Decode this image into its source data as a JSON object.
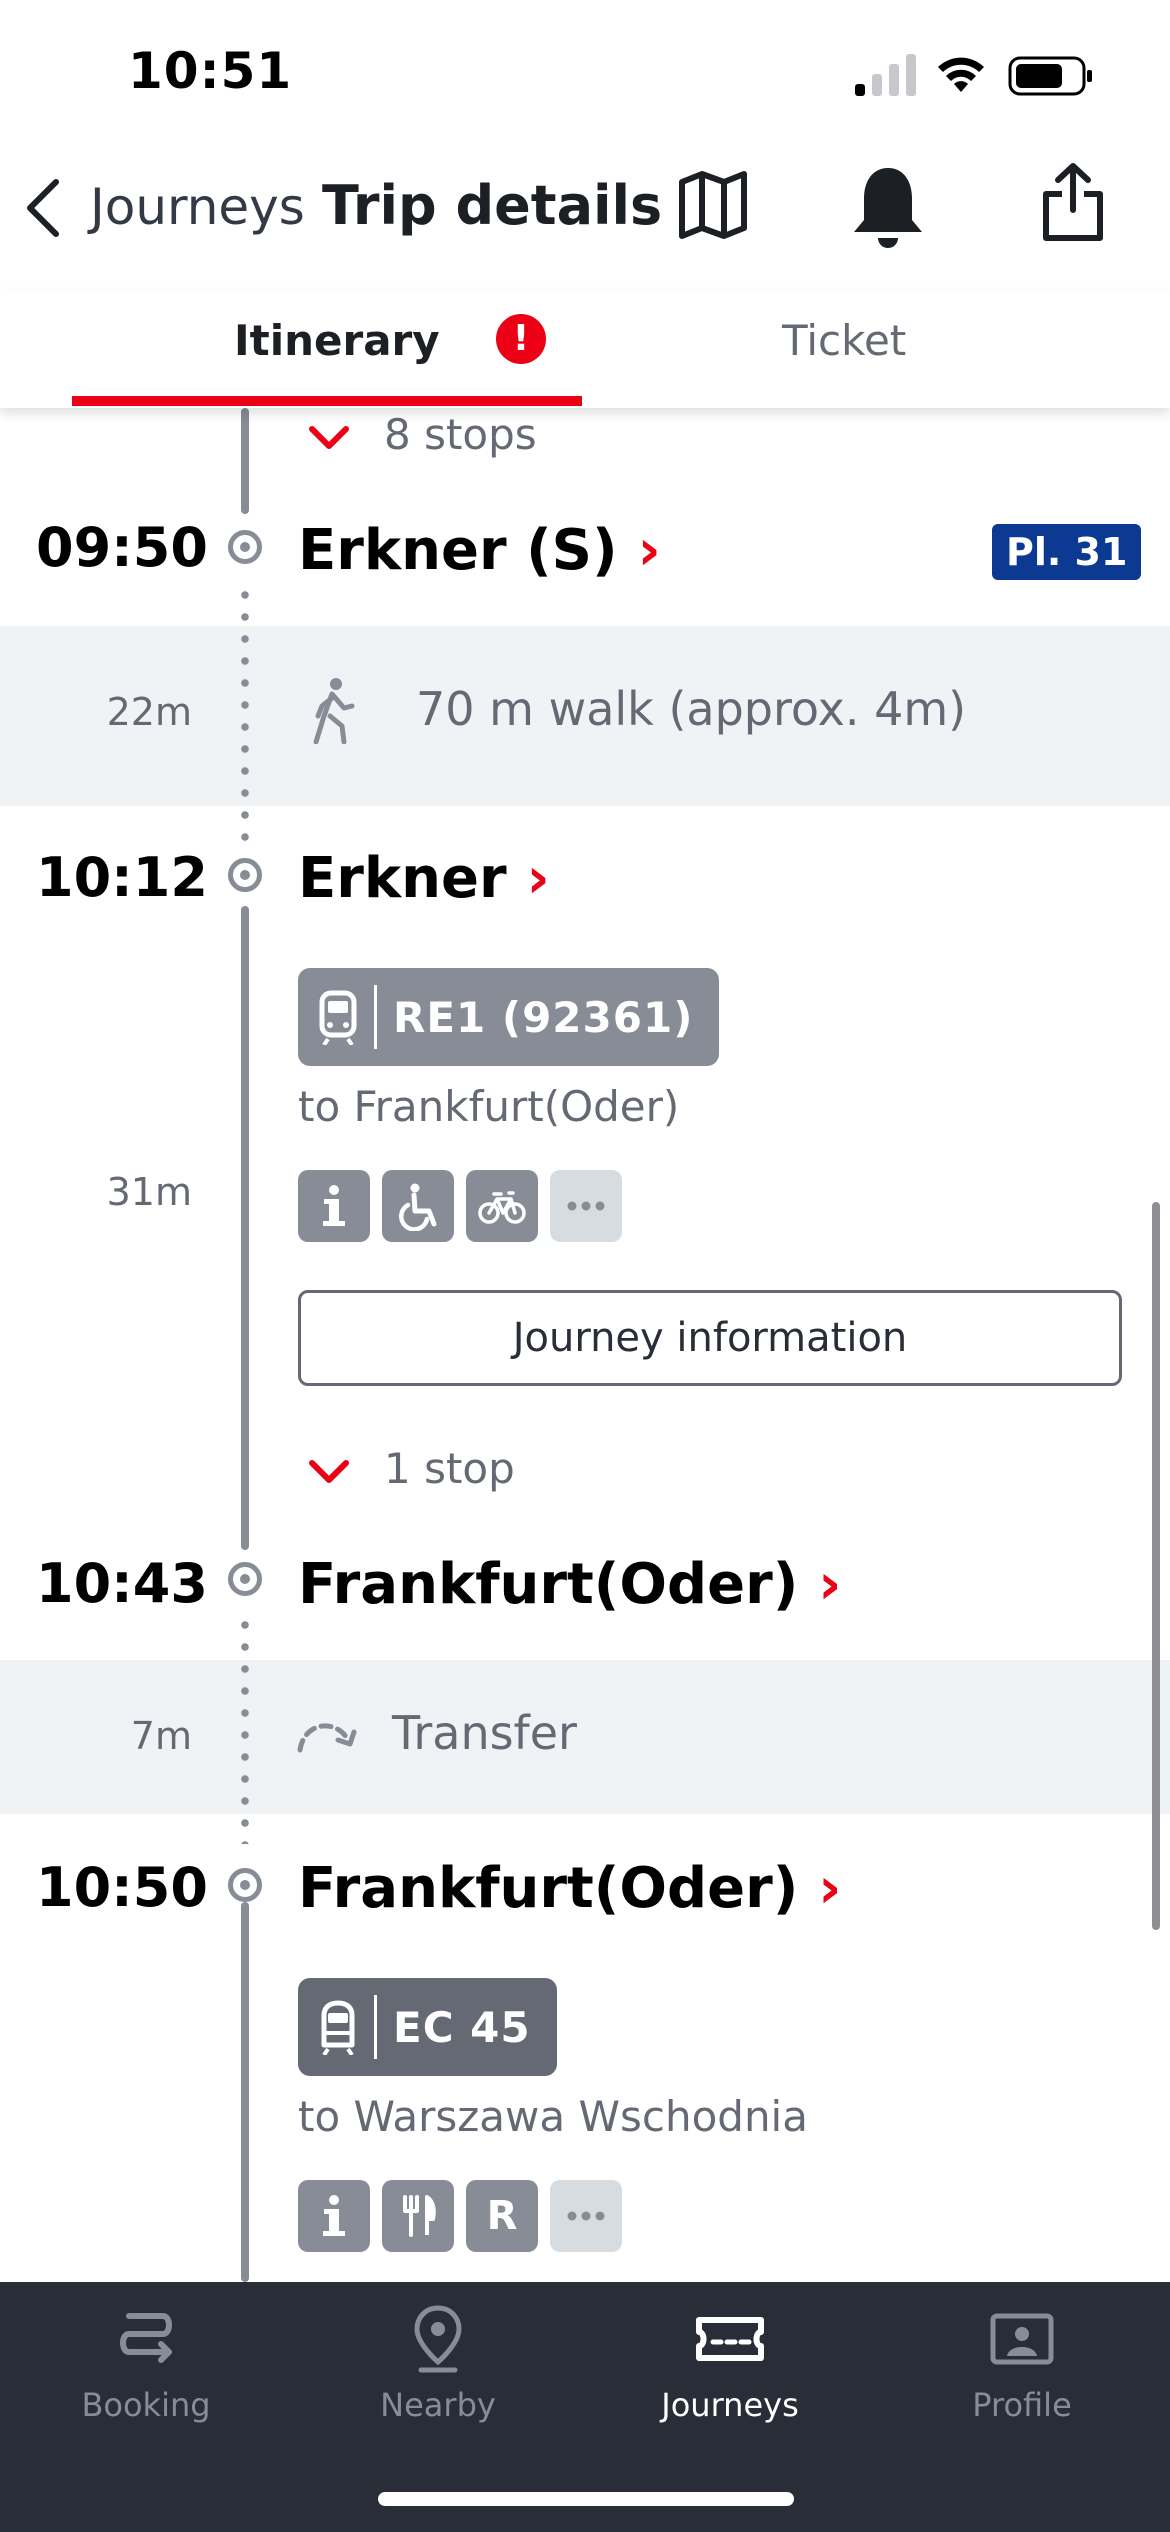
{
  "status_bar": {
    "time": "10:51"
  },
  "header": {
    "back_label": "Journeys",
    "title": "Trip details"
  },
  "tabs": {
    "itinerary": "Itinerary",
    "alert_badge": "!",
    "ticket": "Ticket"
  },
  "timeline": {
    "stops_top": "8 stops",
    "stop1": {
      "time": "09:50",
      "name": "Erkner (S)",
      "platform": "Pl. 31"
    },
    "walk": {
      "duration": "22m",
      "text": "70 m walk (approx. 4m)"
    },
    "stop2": {
      "time": "10:12",
      "name": "Erkner"
    },
    "leg1": {
      "train": "RE1 (92361)",
      "destination": "to Frankfurt(Oder)",
      "duration": "31m",
      "button": "Journey information",
      "stops": "1 stop"
    },
    "stop3": {
      "time": "10:43",
      "name": "Frankfurt(Oder)"
    },
    "transfer": {
      "duration": "7m",
      "text": "Transfer"
    },
    "stop4": {
      "time": "10:50",
      "name": "Frankfurt(Oder)"
    },
    "leg2": {
      "train": "EC 45",
      "destination": "to Warszawa Wschodnia"
    }
  },
  "amenities": {
    "r_label": "R"
  },
  "bottom_nav": [
    {
      "label": "Booking",
      "icon": "route-icon"
    },
    {
      "label": "Nearby",
      "icon": "location-pin-icon"
    },
    {
      "label": "Journeys",
      "icon": "ticket-icon",
      "active": true
    },
    {
      "label": "Profile",
      "icon": "profile-card-icon"
    }
  ],
  "colors": {
    "accent_red": "#ec0016",
    "platform_blue": "#0c3992",
    "nav_bg": "#282d37",
    "band_bg": "#f0f3f5"
  }
}
